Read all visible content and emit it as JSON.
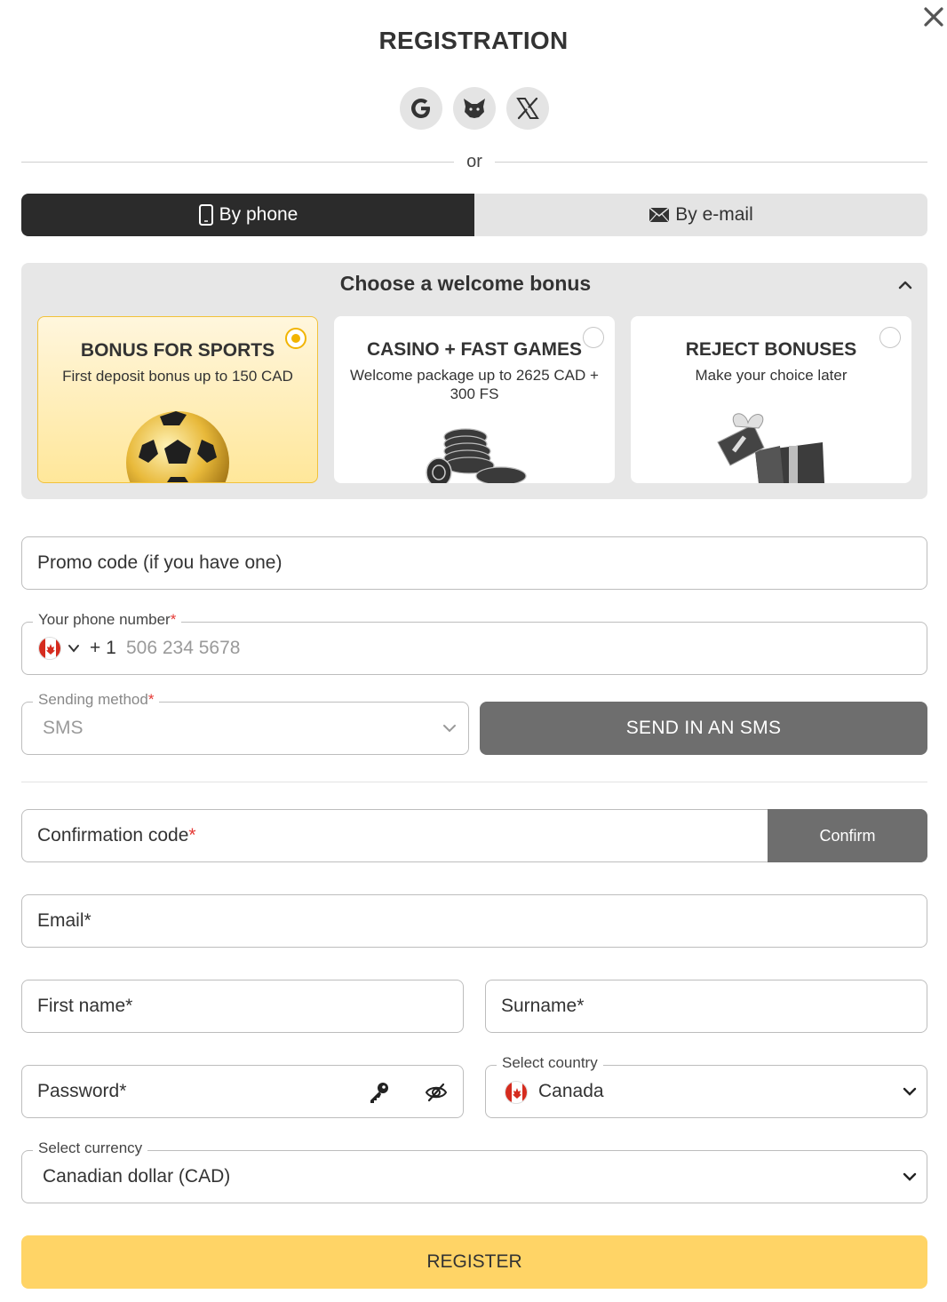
{
  "header": {
    "title": "REGISTRATION",
    "or_text": "or"
  },
  "socials": [
    {
      "name": "google",
      "icon": "google-icon"
    },
    {
      "name": "metamask",
      "icon": "fox-icon"
    },
    {
      "name": "x",
      "icon": "x-logo-icon"
    }
  ],
  "tabs": [
    {
      "label": "By phone",
      "icon": "phone-icon",
      "active": true
    },
    {
      "label": "By e-mail",
      "icon": "envelope-icon",
      "active": false
    }
  ],
  "bonus": {
    "title": "Choose a welcome bonus",
    "options": [
      {
        "title": "BONUS FOR SPORTS",
        "subtitle": "First deposit bonus up to 150 CAD",
        "selected": true,
        "image": "soccer-ball"
      },
      {
        "title": "CASINO + FAST GAMES",
        "subtitle": "Welcome package up to 2625 CAD + 300 FS",
        "selected": false,
        "image": "casino-chips"
      },
      {
        "title": "REJECT BONUSES",
        "subtitle": "Make your choice later",
        "selected": false,
        "image": "gift-box"
      }
    ]
  },
  "form": {
    "promo_placeholder": "Promo code (if you have one)",
    "phone_label": "Your phone number",
    "phone_required": "*",
    "phone_code": "+ 1",
    "phone_placeholder": "506 234 5678",
    "sending_label": "Sending method",
    "sending_required": "*",
    "sending_value": "SMS",
    "send_button": "SEND IN AN SMS",
    "confirmation_label": "Confirmation code",
    "confirmation_required": "*",
    "confirm_button": "Confirm",
    "email_placeholder": "Email*",
    "first_name_placeholder": "First name*",
    "surname_placeholder": "Surname*",
    "password_placeholder": "Password*",
    "country_label": "Select country",
    "country_value": "Canada",
    "currency_label": "Select currency",
    "currency_value": "Canadian dollar (CAD)",
    "register_button": "REGISTER"
  },
  "colors": {
    "accent": "#ffd466",
    "selected_border": "#f2c23a",
    "dark": "#2b2b2b",
    "button_gray": "#6e6e6e",
    "required": "#e53935"
  }
}
